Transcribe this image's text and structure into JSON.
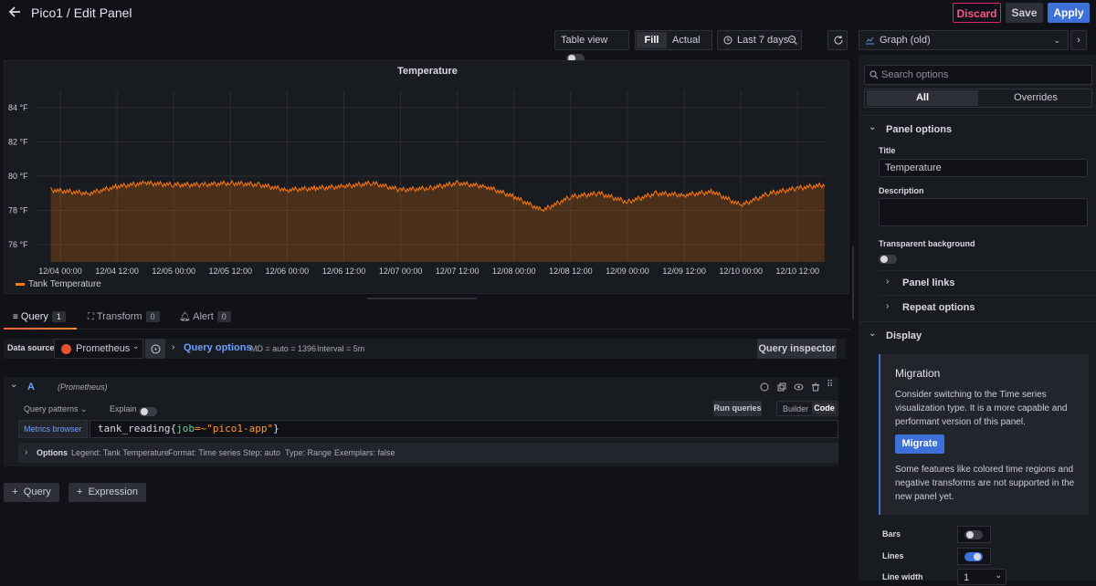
{
  "header": {
    "title": "Pico1 / Edit Panel",
    "discard": "Discard",
    "save": "Save",
    "apply": "Apply"
  },
  "toolbar": {
    "table_view": "Table view",
    "fill": "Fill",
    "actual": "Actual",
    "time_range": "Last 7 days",
    "visualization": "Graph (old)"
  },
  "panel": {
    "title": "Temperature",
    "legend_label": "Tank Temperature"
  },
  "chart_data": {
    "type": "line",
    "y_ticks": [
      "84 °F",
      "82 °F",
      "80 °F",
      "78 °F",
      "76 °F"
    ],
    "y_tick_values": [
      84,
      82,
      80,
      78,
      76
    ],
    "ylim": [
      75,
      85
    ],
    "x_ticks": [
      "12/04 00:00",
      "12/04 12:00",
      "12/05 00:00",
      "12/05 12:00",
      "12/06 00:00",
      "12/06 12:00",
      "12/07 00:00",
      "12/07 12:00",
      "12/08 00:00",
      "12/08 12:00",
      "12/09 00:00",
      "12/09 12:00",
      "12/10 00:00",
      "12/10 12:00"
    ],
    "grid": true,
    "legend_position": "bottom-left",
    "series": [
      {
        "name": "Tank Temperature",
        "color": "#ff780a",
        "x": [
          "12/03 22:00",
          "12/04 06:00",
          "12/04 12:00",
          "12/04 18:00",
          "12/05 00:00",
          "12/05 06:00",
          "12/05 12:00",
          "12/05 18:00",
          "12/06 00:00",
          "12/06 06:00",
          "12/06 12:00",
          "12/06 18:00",
          "12/07 00:00",
          "12/07 06:00",
          "12/07 12:00",
          "12/07 18:00",
          "12/08 00:00",
          "12/08 06:00",
          "12/08 12:00",
          "12/08 18:00",
          "12/09 00:00",
          "12/09 06:00",
          "12/09 12:00",
          "12/09 18:00",
          "12/10 00:00",
          "12/10 06:00",
          "12/10 12:00",
          "12/10 18:00"
        ],
        "values": [
          79.2,
          79.0,
          79.4,
          79.6,
          79.5,
          79.5,
          79.6,
          79.5,
          79.2,
          79.3,
          79.4,
          79.6,
          79.2,
          79.3,
          79.6,
          79.4,
          78.8,
          78.0,
          78.8,
          79.0,
          78.5,
          79.0,
          78.9,
          79.1,
          78.3,
          79.0,
          79.3,
          79.5
        ]
      }
    ]
  },
  "tabs": [
    {
      "label": "Query",
      "count": "1"
    },
    {
      "label": "Transform",
      "count": "0"
    },
    {
      "label": "Alert",
      "count": "0"
    }
  ],
  "query": {
    "datasource_label": "Data source",
    "datasource": "Prometheus",
    "query_options": "Query options",
    "md": "MD = auto = 1396",
    "interval": "Interval = 5m",
    "inspector": "Query inspector",
    "ref_id": "A",
    "ref_source": "(Prometheus)",
    "patterns": "Query patterns",
    "explain": "Explain",
    "run": "Run queries",
    "builder": "Builder",
    "code": "Code",
    "metrics_browser": "Metrics browser",
    "expr_prefix": "tank_reading{",
    "expr_key": "job",
    "expr_op": "=~",
    "expr_val": "\"pico1-app\"",
    "expr_suffix": "}",
    "options_label": "Options",
    "legend": "Legend: Tank Temperature",
    "format": "Format: Time series",
    "step": "Step: auto",
    "qtype": "Type: Range",
    "exemplars": "Exemplars: false",
    "add_query": "Query",
    "add_expression": "Expression"
  },
  "sidebar": {
    "search_placeholder": "Search options",
    "tab_all": "All",
    "tab_overrides": "Overrides",
    "panel_options": "Panel options",
    "title_label": "Title",
    "title_value": "Temperature",
    "description_label": "Description",
    "transparent_label": "Transparent background",
    "panel_links": "Panel links",
    "repeat_options": "Repeat options",
    "display": "Display",
    "migration_title": "Migration",
    "migration_text": "Consider switching to the Time series visualization type. It is a more capable and performant version of this panel.",
    "migrate_button": "Migrate",
    "migration_note": "Some features like colored time regions and negative transforms are not supported in the new panel yet.",
    "bars": "Bars",
    "lines": "Lines",
    "line_width": "Line width",
    "line_width_value": "1"
  }
}
